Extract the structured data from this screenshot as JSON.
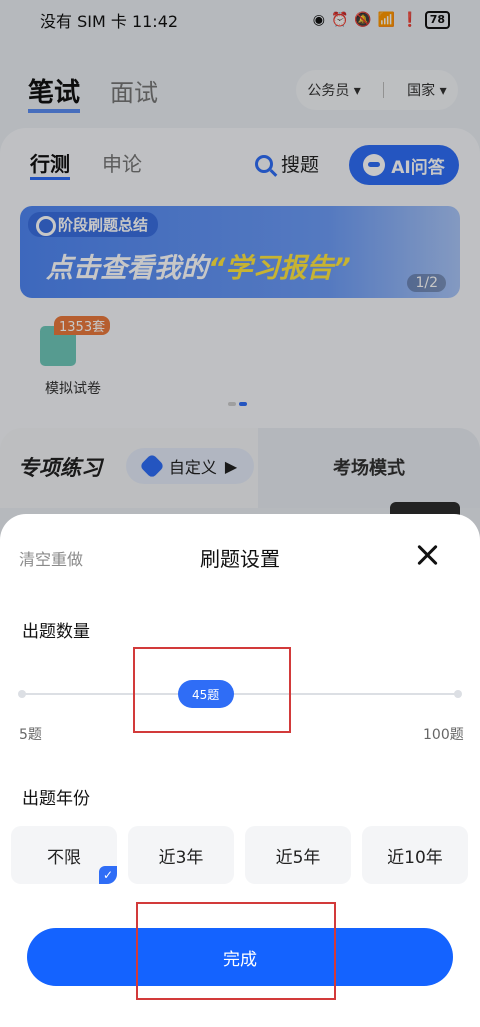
{
  "status_bar": {
    "carrier_time": "没有 SIM 卡 11:42",
    "battery": "78"
  },
  "top_tabs": {
    "active": "笔试",
    "inactive": "面试"
  },
  "filter": {
    "category": "公务员",
    "region": "国家"
  },
  "sub_tabs": {
    "active": "行测",
    "inactive": "申论"
  },
  "search_label": "搜题",
  "ai_button": "AI问答",
  "banner": {
    "tag": "阶段刷题总结",
    "title_prefix": "点击查看我的",
    "title_highlight": "“学习报告”",
    "page": "1/2"
  },
  "mock_exam": {
    "badge": "1353套",
    "label": "模拟试卷"
  },
  "practice": {
    "title": "专项练习",
    "custom": "自定义",
    "exam_mode": "考场模式"
  },
  "sheet": {
    "clear": "清空重做",
    "title": "刷题设置",
    "count_label": "出题数量",
    "slider": {
      "min_label": "5题",
      "max_label": "100题",
      "value_label": "45题",
      "value": 45,
      "min": 5,
      "max": 100
    },
    "year_label": "出题年份",
    "years": [
      "不限",
      "近3年",
      "近5年",
      "近10年"
    ],
    "selected_year": "不限",
    "check": "✓",
    "done": "完成"
  },
  "colors": {
    "accent": "#2f6df6",
    "done_button": "#1463ff",
    "highlight": "#d23a3a"
  },
  "icons": [
    "eye-icon",
    "alarm-icon",
    "mute-icon",
    "wifi-icon",
    "alert-icon",
    "battery-icon",
    "search-icon",
    "ai-bot-icon",
    "close-icon",
    "check-icon"
  ]
}
